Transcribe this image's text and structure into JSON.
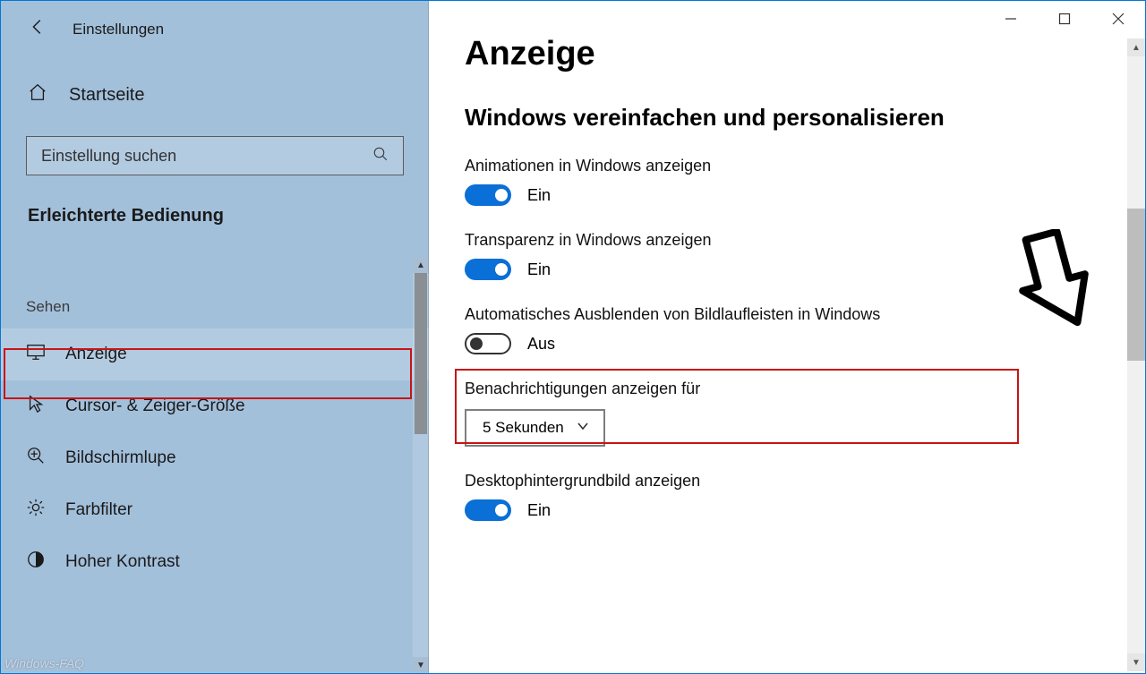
{
  "window": {
    "app_title": "Einstellungen"
  },
  "sidebar": {
    "home_label": "Startseite",
    "search_placeholder": "Einstellung suchen",
    "category_label": "Erleichterte Bedienung",
    "group_label": "Sehen",
    "items": [
      {
        "label": "Anzeige"
      },
      {
        "label": "Cursor- & Zeiger-Größe"
      },
      {
        "label": "Bildschirmlupe"
      },
      {
        "label": "Farbfilter"
      },
      {
        "label": "Hoher Kontrast"
      }
    ]
  },
  "main": {
    "page_title": "Anzeige",
    "section_title": "Windows vereinfachen und personalisieren",
    "settings": {
      "animations": {
        "label": "Animationen in Windows anzeigen",
        "state": "Ein"
      },
      "transparency": {
        "label": "Transparenz in Windows anzeigen",
        "state": "Ein"
      },
      "autohide_scrollbars": {
        "label": "Automatisches Ausblenden von Bildlaufleisten in Windows",
        "state": "Aus"
      },
      "notifications": {
        "label": "Benachrichtigungen anzeigen für",
        "value": "5 Sekunden"
      },
      "desktop_bg": {
        "label": "Desktophintergrundbild anzeigen",
        "state": "Ein"
      }
    }
  },
  "watermark": "Windows-FAQ"
}
